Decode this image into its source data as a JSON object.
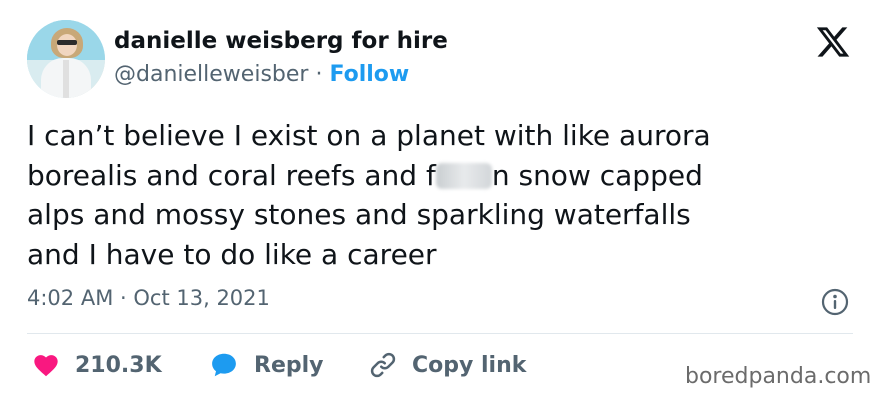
{
  "author": {
    "display_name": "danielle weisberg for hire",
    "handle": "@danielleweisber",
    "separator": "·",
    "follow_label": "Follow",
    "avatar_icon": "profile-photo"
  },
  "tweet": {
    "line1": "I can’t believe I exist on a planet with like aurora",
    "line2_before": "borealis and coral reefs and f",
    "line2_after": "n snow capped",
    "line3": "alps and mossy stones and sparkling waterfalls",
    "line4": "and I have to do like a career"
  },
  "meta": {
    "time": "4:02 AM",
    "separator": "·",
    "date": "Oct 13, 2021"
  },
  "actions": {
    "like_count": "210.3K",
    "reply_label": "Reply",
    "copy_label": "Copy link"
  },
  "icons": {
    "brand": "x-logo-icon",
    "info": "info-icon",
    "like": "heart-icon",
    "reply": "speech-bubble-icon",
    "copy": "link-icon"
  },
  "colors": {
    "link": "#1d9bf0",
    "heart": "#f91880",
    "muted": "#536471",
    "text": "#0f1419"
  },
  "watermark": "boredpanda.com"
}
